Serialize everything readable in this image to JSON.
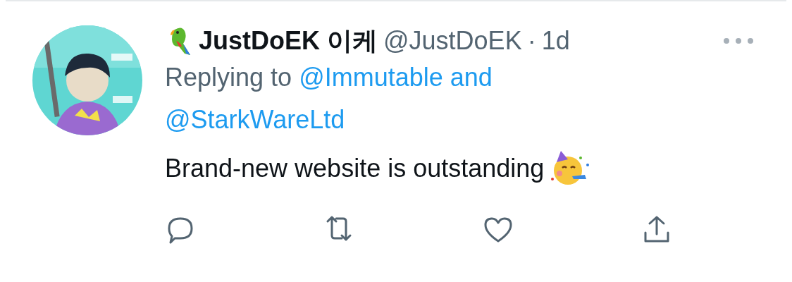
{
  "tweet": {
    "author": {
      "name": "JustDoEK 이케",
      "handle": "@JustDoEK",
      "separator": "·",
      "time": "1d"
    },
    "reply_to": {
      "prefix": "Replying to",
      "mentions": [
        "@Immutable and",
        "@StarkWareLtd"
      ]
    },
    "text": "Brand-new website is outstanding",
    "actions": [
      {
        "kind": "reply"
      },
      {
        "kind": "retweet"
      },
      {
        "kind": "like"
      },
      {
        "kind": "share"
      }
    ]
  }
}
